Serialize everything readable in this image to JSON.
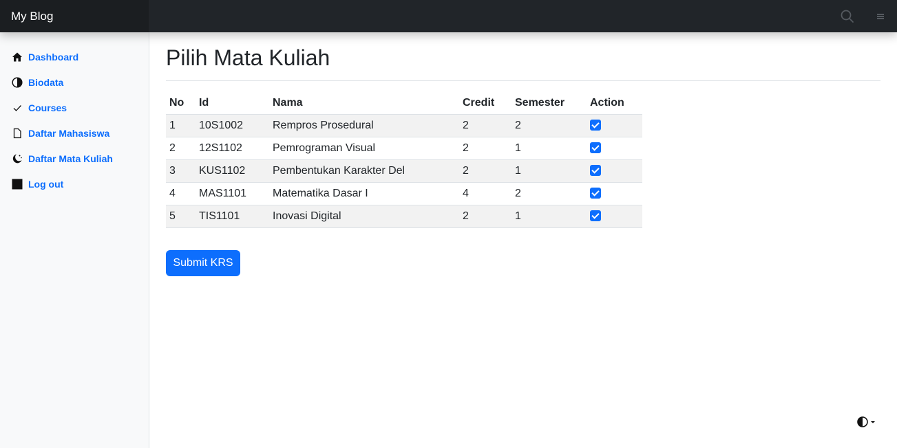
{
  "navbar": {
    "brand": "My Blog",
    "search_icon": "search-icon",
    "menu_icon": "hamburger-icon",
    "background": "#212529"
  },
  "sidebar": {
    "items": [
      {
        "label": "Dashboard",
        "icon": "house-icon"
      },
      {
        "label": "Biodata",
        "icon": "circle-half-icon"
      },
      {
        "label": "Courses",
        "icon": "check-icon"
      },
      {
        "label": "Daftar Mahasiswa",
        "icon": "file-icon"
      },
      {
        "label": "Daftar Mata Kuliah",
        "icon": "moon-stars-icon"
      },
      {
        "label": "Log out",
        "icon": "square-icon"
      }
    ]
  },
  "main": {
    "title": "Pilih Mata Kuliah",
    "table": {
      "headers": [
        "No",
        "Id",
        "Nama",
        "Credit",
        "Semester",
        "Action"
      ],
      "rows": [
        {
          "no": "1",
          "id": "10S1002",
          "nama": "Rempros Prosedural",
          "credit": "2",
          "semester": "2",
          "checked": true
        },
        {
          "no": "2",
          "id": "12S1102",
          "nama": "Pemrograman Visual",
          "credit": "2",
          "semester": "1",
          "checked": true
        },
        {
          "no": "3",
          "id": "KUS1102",
          "nama": "Pembentukan Karakter Del",
          "credit": "2",
          "semester": "1",
          "checked": true
        },
        {
          "no": "4",
          "id": "MAS1101",
          "nama": "Matematika Dasar I",
          "credit": "4",
          "semester": "2",
          "checked": true
        },
        {
          "no": "5",
          "id": "TIS1101",
          "nama": "Inovasi Digital",
          "credit": "2",
          "semester": "1",
          "checked": true
        }
      ]
    },
    "submit_label": "Submit KRS"
  },
  "theme_toggle": {
    "icon": "circle-half-icon"
  },
  "colors": {
    "accent": "#0d6efd",
    "sidebar_bg": "#f8f9fa",
    "stripe": "#f2f2f2"
  }
}
